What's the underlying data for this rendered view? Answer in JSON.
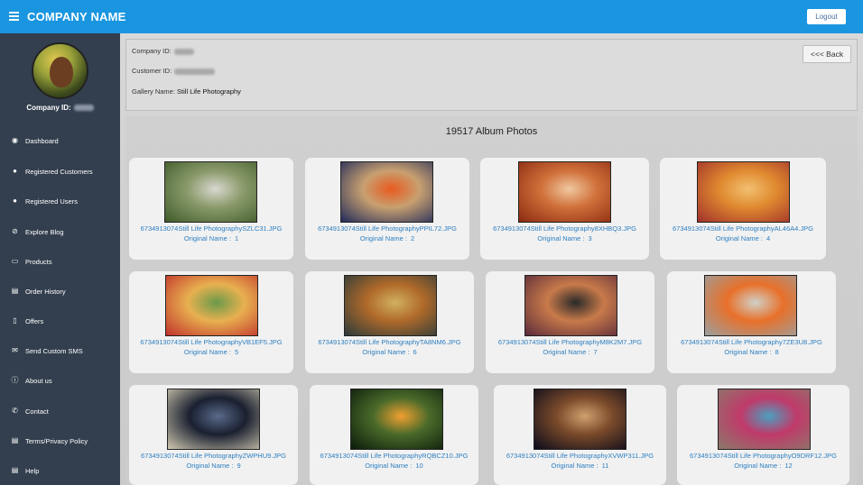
{
  "app": {
    "brand": "COMPANY NAME",
    "logout_label": "Logout"
  },
  "sidebar": {
    "company_id_label": "Company ID:",
    "items": [
      {
        "label": "Dashboard",
        "icon": "dashboard-icon",
        "glyph": "◉"
      },
      {
        "label": "Registered Customers",
        "icon": "user-icon",
        "glyph": "●"
      },
      {
        "label": "Registered Users",
        "icon": "users-icon",
        "glyph": "●"
      },
      {
        "label": "Explore Blog",
        "icon": "compass-icon",
        "glyph": "⊘"
      },
      {
        "label": "Products",
        "icon": "tag-icon",
        "glyph": "▭"
      },
      {
        "label": "Order History",
        "icon": "book-icon",
        "glyph": "▤"
      },
      {
        "label": "Offers",
        "icon": "mobile-icon",
        "glyph": "▯"
      },
      {
        "label": "Send Custom SMS",
        "icon": "envelope-icon",
        "glyph": "✉"
      },
      {
        "label": "About us",
        "icon": "info-icon",
        "glyph": "ⓘ"
      },
      {
        "label": "Contact",
        "icon": "phone-icon",
        "glyph": "✆"
      },
      {
        "label": "Terms/Privacy Policy",
        "icon": "document-icon",
        "glyph": "▤"
      },
      {
        "label": "Help",
        "icon": "help-document-icon",
        "glyph": "▤"
      }
    ]
  },
  "info": {
    "company_id_label": "Company ID:",
    "customer_id_label": "Customer ID:",
    "gallery_name_label": "Gallery Name:",
    "gallery_name": "Still Life Photography",
    "back_label": "<<< Back"
  },
  "gallery": {
    "count_text": "19517 Album Photos",
    "original_name_label": "Original Name :",
    "photos": [
      {
        "file": "6734913074Still Life PhotographySZLC31.JPG",
        "original": "1",
        "colors": [
          "#3f5a2a",
          "#8a9a6a",
          "#d8d8d0"
        ]
      },
      {
        "file": "6734913074Still Life PhotographyPPIL72.JPG",
        "original": "2",
        "colors": [
          "#1f2a5a",
          "#c8a070",
          "#e85a20"
        ]
      },
      {
        "file": "6734913074Still Life Photography8XHBQ3.JPG",
        "original": "3",
        "colors": [
          "#8a2a10",
          "#d0703a",
          "#f0c8a0"
        ]
      },
      {
        "file": "6734913074Still Life PhotographyAL46A4.JPG",
        "original": "4",
        "colors": [
          "#a0302a",
          "#e08a30",
          "#f2c070"
        ]
      },
      {
        "file": "6734913074Still Life PhotographyVB1EF5.JPG",
        "original": "5",
        "colors": [
          "#c0302a",
          "#e8b050",
          "#6a9a4a"
        ]
      },
      {
        "file": "6734913074Still Life PhotographyTA8NM6.JPG",
        "original": "6",
        "colors": [
          "#2a3a3a",
          "#b06a2a",
          "#d0b060"
        ]
      },
      {
        "file": "6734913074Still Life PhotographyM8K2M7.JPG",
        "original": "7",
        "colors": [
          "#5a2a3a",
          "#c87a4a",
          "#2a2a2a"
        ]
      },
      {
        "file": "6734913074Still Life Photography7ZE3U8.JPG",
        "original": "8",
        "colors": [
          "#9aa0a0",
          "#e8702a",
          "#d0d0c8"
        ]
      },
      {
        "file": "6734913074Still Life PhotographyZWPHU9.JPG",
        "original": "9",
        "colors": [
          "#d0c8b0",
          "#1a2030",
          "#5a6a8a"
        ]
      },
      {
        "file": "6734913074Still Life PhotographyRQBCZ10.JPG",
        "original": "10",
        "colors": [
          "#0a1a0a",
          "#4a6a2a",
          "#f0a030"
        ]
      },
      {
        "file": "6734913074Still Life PhotographyXVWP311.JPG",
        "original": "11",
        "colors": [
          "#0a0a1a",
          "#7a4a2a",
          "#d0a070"
        ]
      },
      {
        "file": "6734913074Still Life PhotographyO9DRF12.JPG",
        "original": "12",
        "colors": [
          "#8a7a6a",
          "#c03a6a",
          "#4aa0c0"
        ]
      }
    ]
  }
}
